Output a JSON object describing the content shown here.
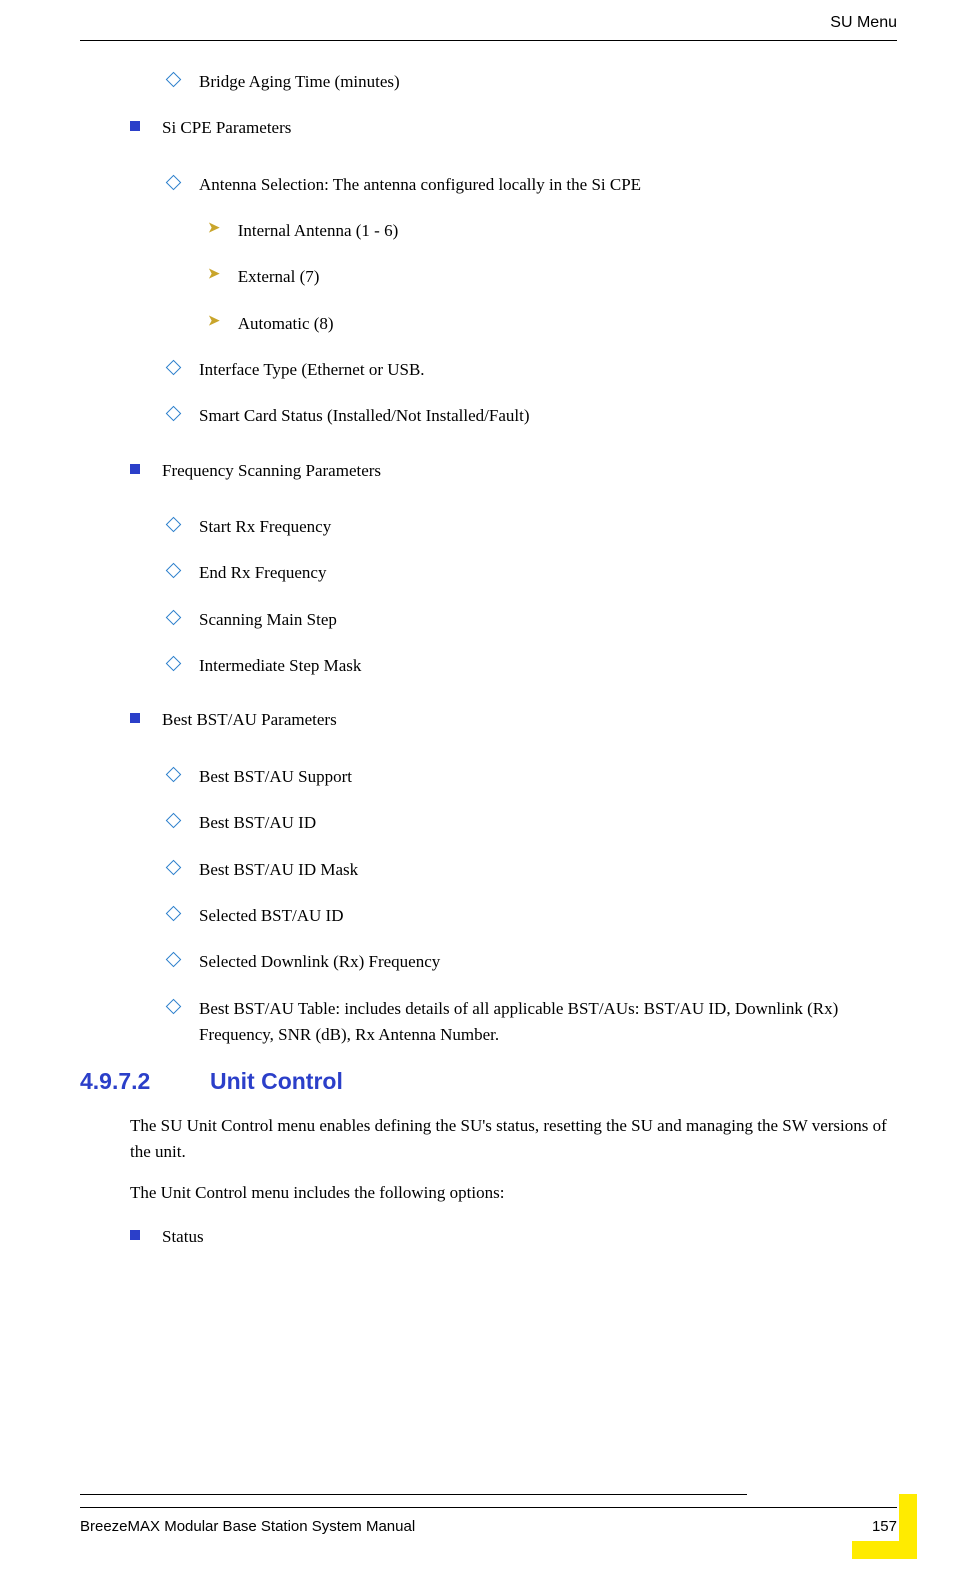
{
  "header": {
    "title": "SU Menu"
  },
  "items": {
    "bridge_aging": "Bridge Aging Time (minutes)",
    "si_cpe": "Si CPE Parameters",
    "antenna_sel": "Antenna Selection: The antenna configured locally in the Si CPE",
    "internal_ant": "Internal Antenna (1 - 6)",
    "external": "External (7)",
    "automatic": "Automatic (8)",
    "iface_type": "Interface Type (Ethernet or USB.",
    "smart_card": "Smart Card Status (Installed/Not Installed/Fault)",
    "freq_scan": "Frequency Scanning Parameters",
    "start_rx": "Start Rx Frequency",
    "end_rx": "End Rx Frequency",
    "scan_main": "Scanning Main Step",
    "inter_mask": "Intermediate Step Mask",
    "best_params": "Best BST/AU Parameters",
    "best_support": "Best BST/AU Support",
    "best_id": "Best BST/AU ID",
    "best_id_mask": "Best BST/AU ID Mask",
    "sel_id": "Selected BST/AU ID",
    "sel_dl": "Selected Downlink (Rx) Frequency",
    "best_table": "Best BST/AU Table: includes details of all applicable BST/AUs: BST/AU ID, Downlink (Rx) Frequency, SNR (dB), Rx Antenna Number.",
    "status": "Status"
  },
  "section": {
    "number": "4.9.7.2",
    "title": "Unit Control",
    "p1": "The SU Unit Control menu enables defining the SU's status, resetting the SU and managing the SW versions of the unit.",
    "p2": "The Unit Control menu includes the following options:"
  },
  "footer": {
    "left": "BreezeMAX Modular Base Station System Manual",
    "right": "157"
  }
}
